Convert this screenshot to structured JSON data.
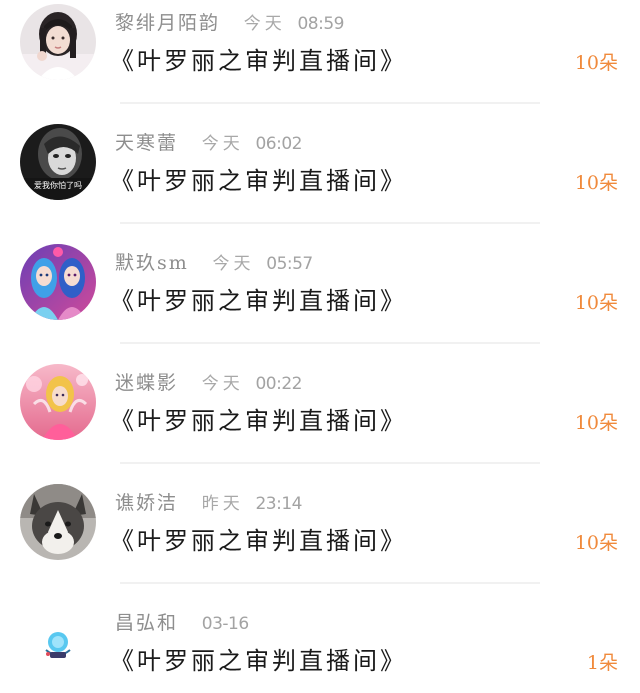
{
  "items": [
    {
      "username": "黎绯月陌韵",
      "day": "今天",
      "time": "08:59",
      "message": "《叶罗丽之审判直播间》",
      "gift": "10朵",
      "avatar_icon": "girl-photo-avatar",
      "avatar_caption": ""
    },
    {
      "username": "天寒蕾",
      "day": "今天",
      "time": "06:02",
      "message": "《叶罗丽之审判直播间》",
      "gift": "10朵",
      "avatar_icon": "bw-portrait-avatar",
      "avatar_caption": "爱我你怕了吗"
    },
    {
      "username": "默玖sm",
      "day": "今天",
      "time": "05:57",
      "message": "《叶罗丽之审判直播间》",
      "gift": "10朵",
      "avatar_icon": "anime-dolls-avatar",
      "avatar_caption": ""
    },
    {
      "username": "迷蝶影",
      "day": "今天",
      "time": "00:22",
      "message": "《叶罗丽之审判直播间》",
      "gift": "10朵",
      "avatar_icon": "pink-fairy-avatar",
      "avatar_caption": ""
    },
    {
      "username": "谯娇洁",
      "day": "昨天",
      "time": "23:14",
      "message": "《叶罗丽之审判直播间》",
      "gift": "10朵",
      "avatar_icon": "husky-dog-avatar",
      "avatar_caption": ""
    },
    {
      "username": "昌弘和",
      "day": "",
      "time": "03-16",
      "message": "《叶罗丽之审判直播间》",
      "gift": "1朵",
      "avatar_icon": "blue-cartoon-avatar",
      "avatar_caption": ""
    }
  ],
  "colors": {
    "gift": "#f08a3c",
    "username": "#8e8e8e",
    "message": "#1a1a1a",
    "divider": "#f1f1f1"
  }
}
